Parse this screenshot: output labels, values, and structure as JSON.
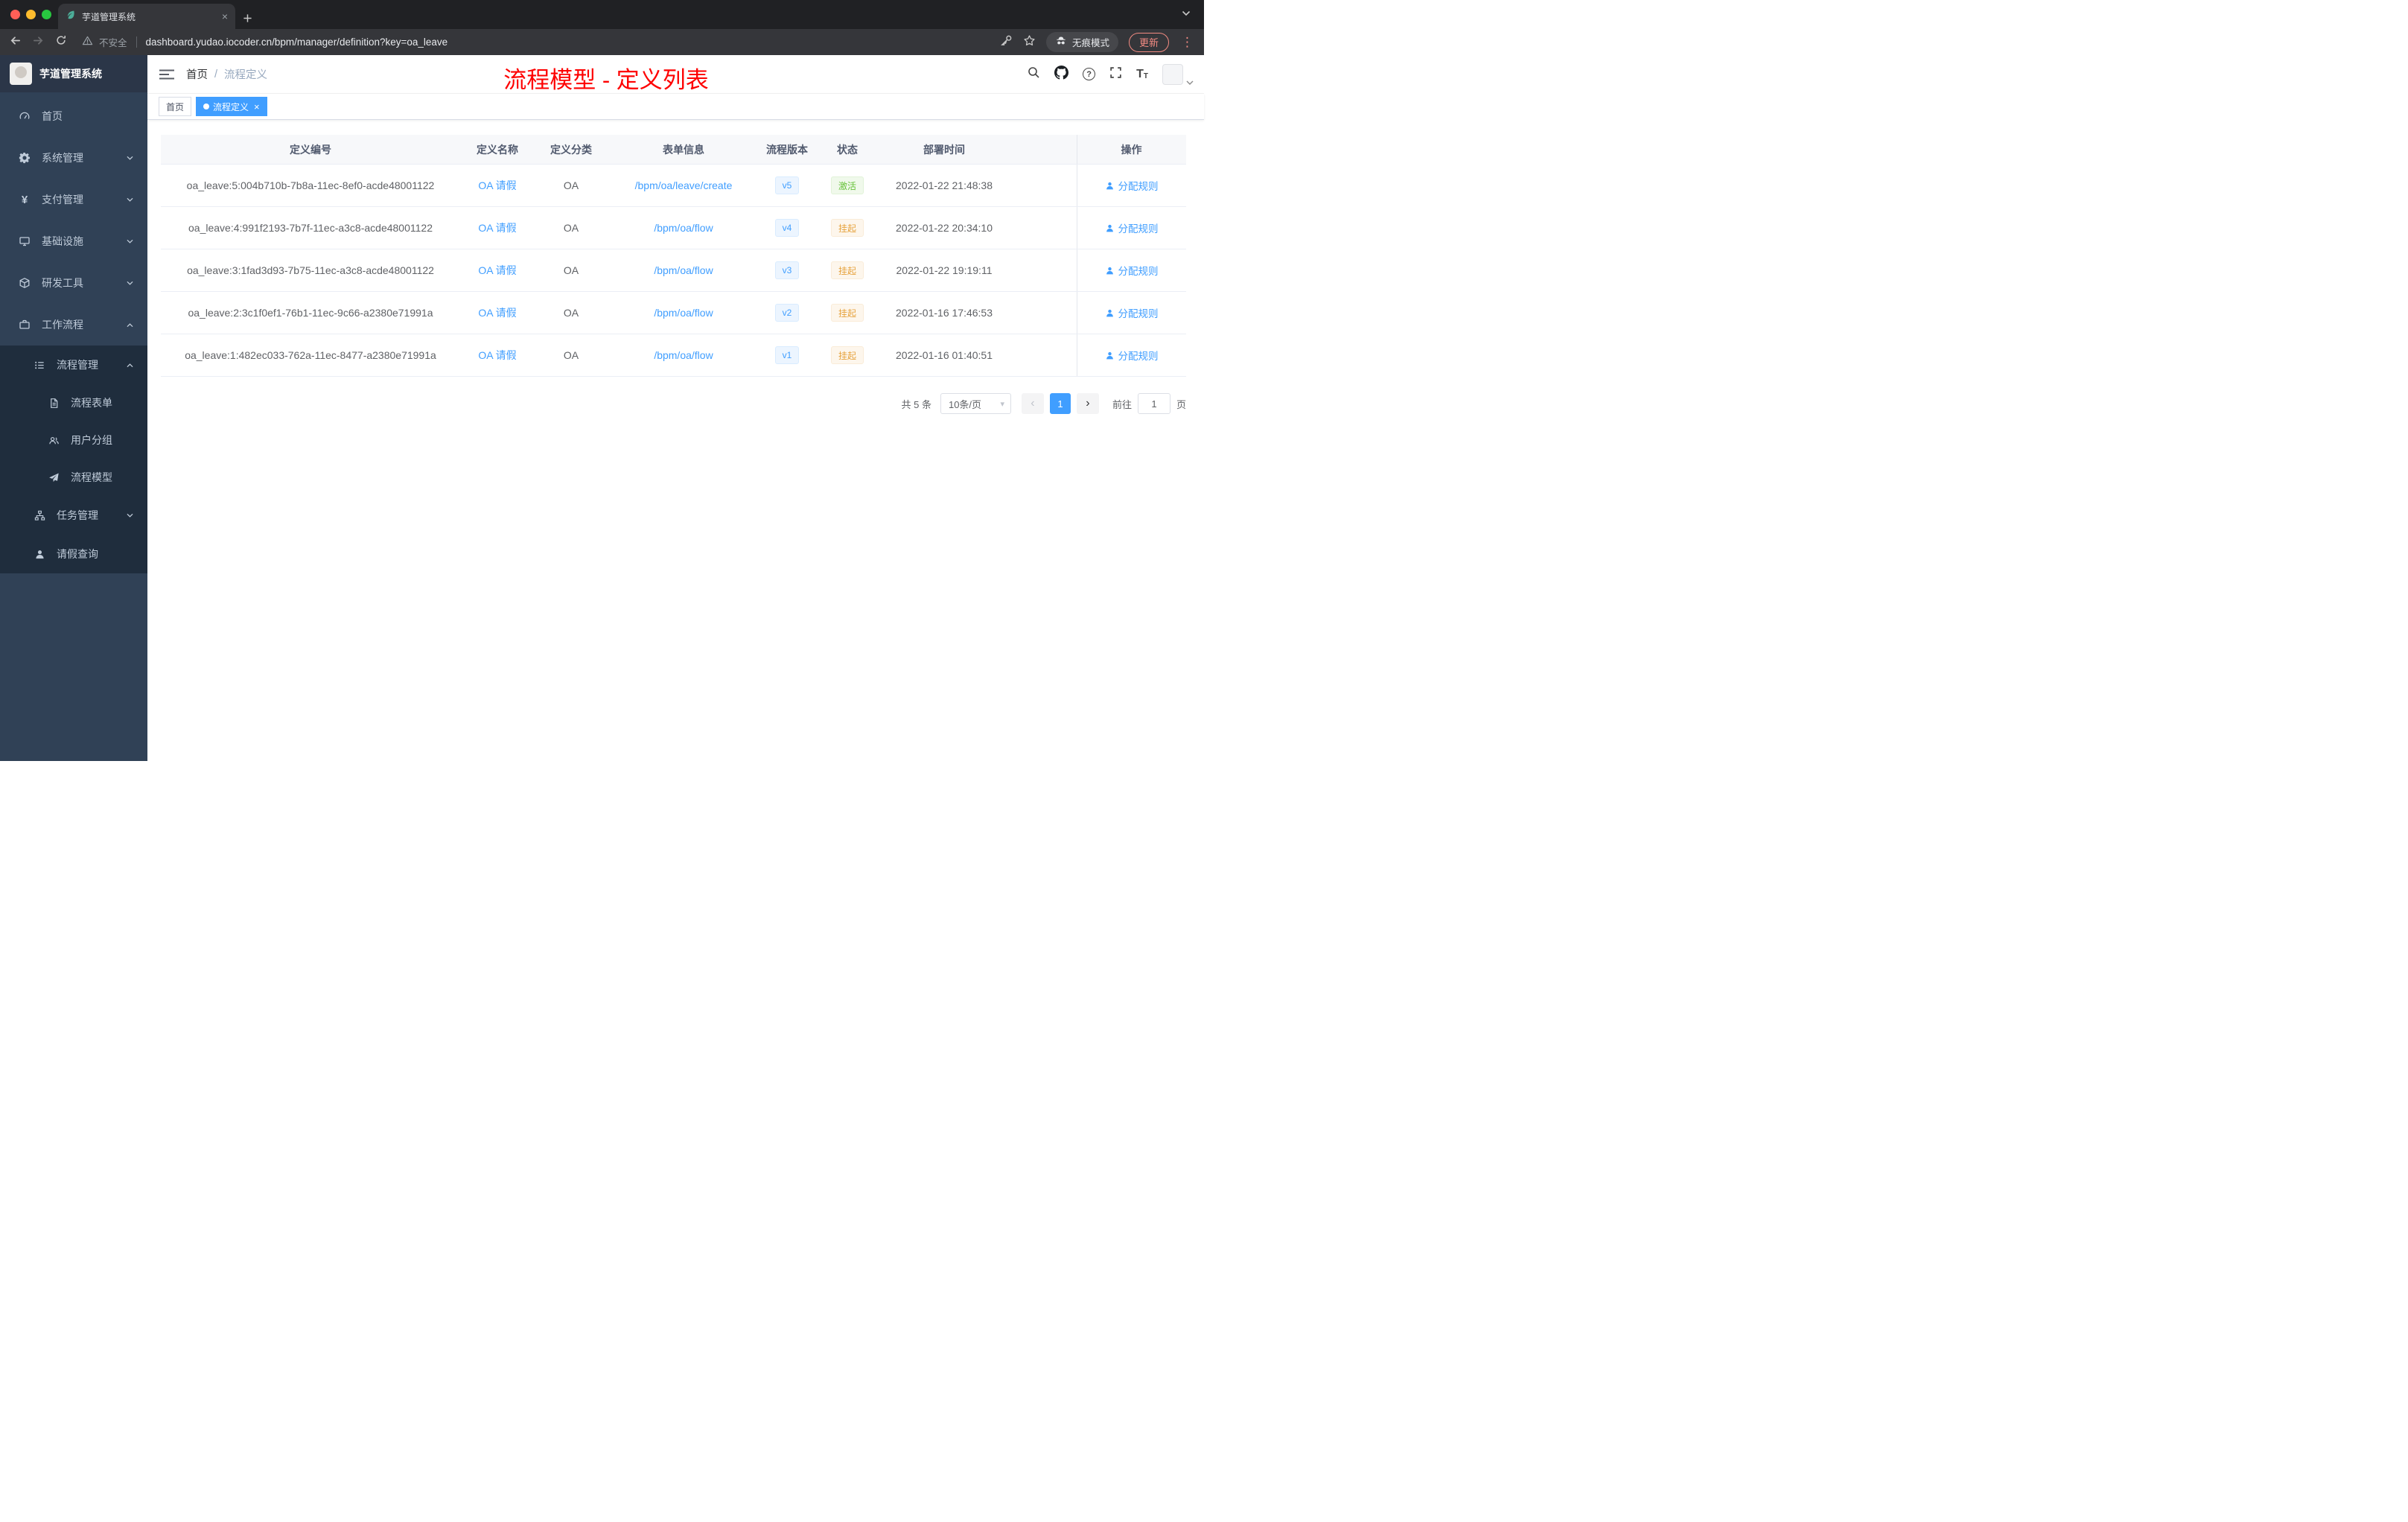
{
  "colors": {
    "accent": "#409eff",
    "success_text": "#67c23a",
    "warning_text": "#e6a23c",
    "annotation_red": "#fe0000",
    "sidebar_bg": "#304156"
  },
  "icons": {
    "tab_close": "×",
    "tag_close": "×",
    "kebab": "⋮",
    "prev": "‹",
    "next": "›",
    "select_caret": "▾",
    "help": "?",
    "font_size_large": "T",
    "font_size_small": "T",
    "yen": "¥"
  },
  "browser": {
    "tab_title": "芋道管理系统",
    "security_label": "不安全",
    "url": "dashboard.yudao.iocoder.cn/bpm/manager/definition?key=oa_leave",
    "incognito_label": "无痕模式",
    "update_label": "更新"
  },
  "sidebar": {
    "app_title": "芋道管理系统",
    "items": [
      {
        "label": "首页"
      },
      {
        "label": "系统管理"
      },
      {
        "label": "支付管理"
      },
      {
        "label": "基础设施"
      },
      {
        "label": "研发工具"
      },
      {
        "label": "工作流程"
      },
      {
        "label": "流程管理"
      },
      {
        "label": "流程表单"
      },
      {
        "label": "用户分组"
      },
      {
        "label": "流程模型"
      },
      {
        "label": "任务管理"
      },
      {
        "label": "请假查询"
      }
    ]
  },
  "header": {
    "breadcrumb": {
      "home": "首页",
      "separator": "/",
      "current": "流程定义"
    },
    "annotation": "流程模型 - 定义列表"
  },
  "tags": {
    "home": "首页",
    "active": "流程定义"
  },
  "table": {
    "columns": [
      "定义编号",
      "定义名称",
      "定义分类",
      "表单信息",
      "流程版本",
      "状态",
      "部署时间",
      "操作"
    ],
    "action_label": "分配规则",
    "rows": [
      {
        "id": "oa_leave:5:004b710b-7b8a-11ec-8ef0-acde48001122",
        "name": "OA 请假",
        "category": "OA",
        "form": "/bpm/oa/leave/create",
        "version": "v5",
        "status": "激活",
        "time": "2022-01-22 21:48:38"
      },
      {
        "id": "oa_leave:4:991f2193-7b7f-11ec-a3c8-acde48001122",
        "name": "OA 请假",
        "category": "OA",
        "form": "/bpm/oa/flow",
        "version": "v4",
        "status": "挂起",
        "time": "2022-01-22 20:34:10"
      },
      {
        "id": "oa_leave:3:1fad3d93-7b75-11ec-a3c8-acde48001122",
        "name": "OA 请假",
        "category": "OA",
        "form": "/bpm/oa/flow",
        "version": "v3",
        "status": "挂起",
        "time": "2022-01-22 19:19:11"
      },
      {
        "id": "oa_leave:2:3c1f0ef1-76b1-11ec-9c66-a2380e71991a",
        "name": "OA 请假",
        "category": "OA",
        "form": "/bpm/oa/flow",
        "version": "v2",
        "status": "挂起",
        "time": "2022-01-16 17:46:53"
      },
      {
        "id": "oa_leave:1:482ec033-762a-11ec-8477-a2380e71991a",
        "name": "OA 请假",
        "category": "OA",
        "form": "/bpm/oa/flow",
        "version": "v1",
        "status": "挂起",
        "time": "2022-01-16 01:40:51"
      }
    ]
  },
  "pagination": {
    "total": "共 5 条",
    "page_size": "10条/页",
    "current_page": "1",
    "goto_label": "前往",
    "goto_value": "1",
    "page_unit": "页"
  }
}
